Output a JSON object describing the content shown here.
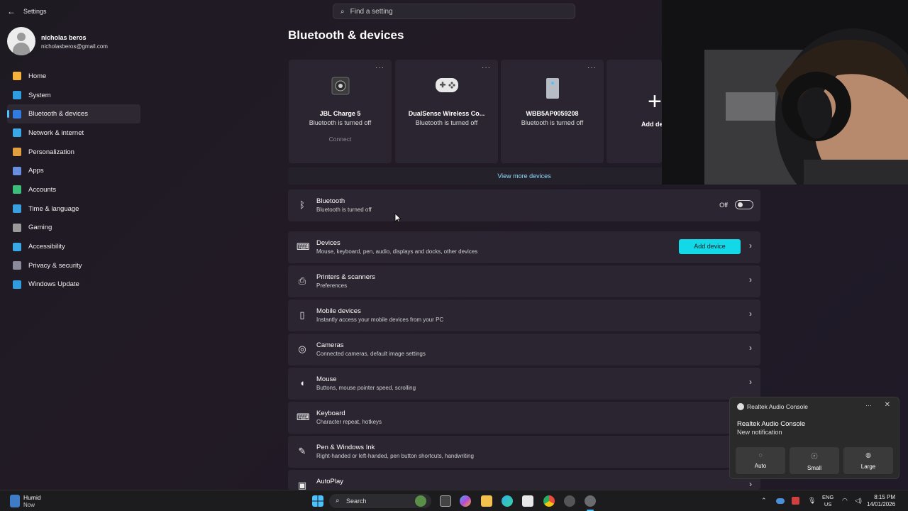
{
  "window": {
    "title": "Settings",
    "search_placeholder": "Find a setting"
  },
  "profile": {
    "name": "nicholas beros",
    "email": "nicholasberos@gmail.com"
  },
  "nav": {
    "items": [
      {
        "label": "Home",
        "icon": "home-icon",
        "color": "#f7b23b"
      },
      {
        "label": "System",
        "icon": "system-icon",
        "color": "#2f9de0"
      },
      {
        "label": "Bluetooth & devices",
        "icon": "bluetooth-icon",
        "color": "#2f7de0",
        "active": true
      },
      {
        "label": "Network & internet",
        "icon": "wifi-icon",
        "color": "#3aa8e6"
      },
      {
        "label": "Personalization",
        "icon": "brush-icon",
        "color": "#e0a040"
      },
      {
        "label": "Apps",
        "icon": "apps-icon",
        "color": "#6a8fe0"
      },
      {
        "label": "Accounts",
        "icon": "accounts-icon",
        "color": "#3ac07a"
      },
      {
        "label": "Time & language",
        "icon": "globe-clock-icon",
        "color": "#3a9fe0"
      },
      {
        "label": "Gaming",
        "icon": "gaming-icon",
        "color": "#9a9a9a"
      },
      {
        "label": "Accessibility",
        "icon": "accessibility-icon",
        "color": "#3aa8e6"
      },
      {
        "label": "Privacy & security",
        "icon": "shield-icon",
        "color": "#8a8a9a"
      },
      {
        "label": "Windows Update",
        "icon": "update-icon",
        "color": "#2f9de0"
      }
    ]
  },
  "page": {
    "title": "Bluetooth & devices"
  },
  "devices": [
    {
      "name": "JBL Charge 5",
      "status": "Bluetooth is turned off",
      "action": "Connect",
      "icon": "speaker-icon"
    },
    {
      "name": "DualSense Wireless Co...",
      "status": "Bluetooth is turned off",
      "icon": "gamepad-icon"
    },
    {
      "name": "WBB5AP0059208",
      "status": "Bluetooth is turned off",
      "icon": "device-icon"
    }
  ],
  "add_card": {
    "label": "Add de"
  },
  "view_more": "View more devices",
  "bluetooth_row": {
    "title": "Bluetooth",
    "subtitle": "Bluetooth is turned off",
    "toggle_label": "Off",
    "toggle_on": false
  },
  "rows": [
    {
      "title": "Devices",
      "subtitle": "Mouse, keyboard, pen, audio, displays and docks, other devices",
      "icon": "devices-icon",
      "glyph": "⌨",
      "button": "Add device"
    },
    {
      "title": "Printers & scanners",
      "subtitle": "Preferences",
      "icon": "printer-icon",
      "glyph": "⎙"
    },
    {
      "title": "Mobile devices",
      "subtitle": "Instantly access your mobile devices from your PC",
      "icon": "phone-icon",
      "glyph": "▯"
    },
    {
      "title": "Cameras",
      "subtitle": "Connected cameras, default image settings",
      "icon": "camera-icon",
      "glyph": "◎"
    },
    {
      "title": "Mouse",
      "subtitle": "Buttons, mouse pointer speed, scrolling",
      "icon": "mouse-icon",
      "glyph": "◖"
    },
    {
      "title": "Keyboard",
      "subtitle": "Character repeat, hotkeys",
      "icon": "keyboard-icon",
      "glyph": "⌨"
    },
    {
      "title": "Pen & Windows Ink",
      "subtitle": "Right-handed or left-handed, pen button shortcuts, handwriting",
      "icon": "pen-icon",
      "glyph": "✎"
    },
    {
      "title": "AutoPlay",
      "subtitle": "",
      "icon": "autoplay-icon",
      "glyph": "▣"
    }
  ],
  "notification": {
    "app": "Realtek Audio Console",
    "title": "Realtek Audio Console",
    "body": "New notification",
    "buttons": [
      {
        "label": "Auto",
        "glyph": "◌"
      },
      {
        "label": "Small",
        "glyph": "ⓡ"
      },
      {
        "label": "Large",
        "glyph": "◍"
      }
    ]
  },
  "taskbar": {
    "weather": "Humid",
    "weather_sub": "Now",
    "search": "Search",
    "lang_top": "ENG",
    "lang_bottom": "US",
    "time": "8:15 PM",
    "date": "14/01/2026"
  },
  "colors": {
    "accent": "#4cc2ff",
    "add_device": "#12d8e8"
  }
}
